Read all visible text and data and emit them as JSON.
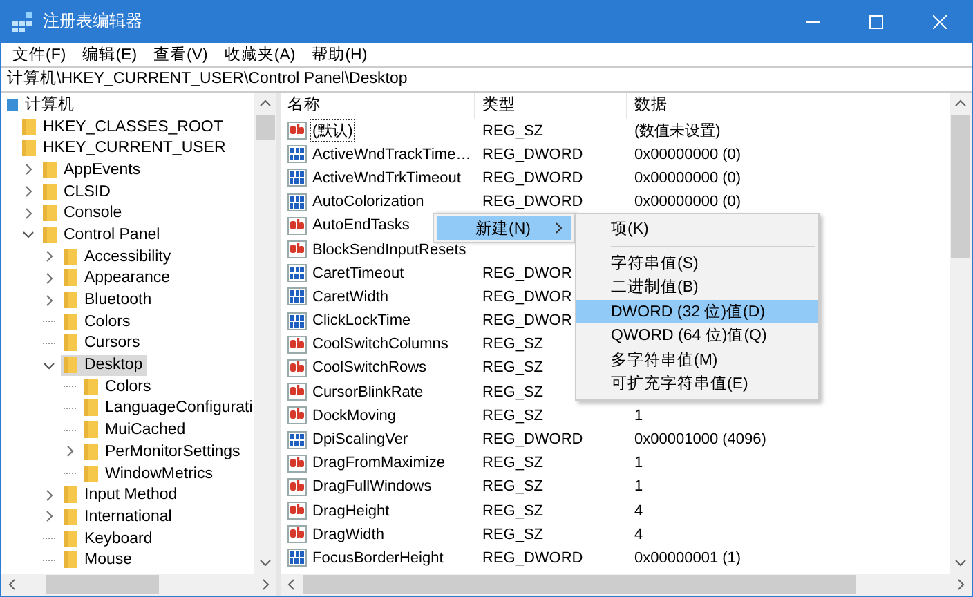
{
  "window": {
    "title": "注册表编辑器"
  },
  "menu": [
    "文件(F)",
    "编辑(E)",
    "查看(V)",
    "收藏夹(A)",
    "帮助(H)"
  ],
  "address": "计算机\\HKEY_CURRENT_USER\\Control Panel\\Desktop",
  "tree": {
    "items": [
      {
        "label": "计算机",
        "kind": "computer",
        "selected": false,
        "children": [
          {
            "label": "HKEY_CLASSES_ROOT",
            "kind": "folder",
            "selected": false
          },
          {
            "label": "HKEY_CURRENT_USER",
            "kind": "folder",
            "selected": false,
            "children": [
              {
                "label": "AppEvents",
                "kind": "folder",
                "expanded": false,
                "selected": false
              },
              {
                "label": "CLSID",
                "kind": "folder",
                "expanded": false,
                "selected": false
              },
              {
                "label": "Console",
                "kind": "folder",
                "expanded": false,
                "selected": false
              },
              {
                "label": "Control Panel",
                "kind": "folder",
                "expanded": true,
                "selected": false,
                "children": [
                  {
                    "label": "Accessibility",
                    "kind": "folder",
                    "expanded": false,
                    "selected": false
                  },
                  {
                    "label": "Appearance",
                    "kind": "folder",
                    "expanded": false,
                    "selected": false
                  },
                  {
                    "label": "Bluetooth",
                    "kind": "folder",
                    "expanded": false,
                    "selected": false
                  },
                  {
                    "label": "Colors",
                    "kind": "folder",
                    "selected": false
                  },
                  {
                    "label": "Cursors",
                    "kind": "folder",
                    "selected": false
                  },
                  {
                    "label": "Desktop",
                    "kind": "folder",
                    "expanded": true,
                    "selected": true,
                    "children": [
                      {
                        "label": "Colors",
                        "kind": "folder",
                        "selected": false
                      },
                      {
                        "label": "LanguageConfigurati",
                        "kind": "folder",
                        "selected": false
                      },
                      {
                        "label": "MuiCached",
                        "kind": "folder",
                        "selected": false
                      },
                      {
                        "label": "PerMonitorSettings",
                        "kind": "folder",
                        "expanded": false,
                        "selected": false
                      },
                      {
                        "label": "WindowMetrics",
                        "kind": "folder",
                        "selected": false
                      }
                    ]
                  },
                  {
                    "label": "Input Method",
                    "kind": "folder",
                    "expanded": false,
                    "selected": false
                  },
                  {
                    "label": "International",
                    "kind": "folder",
                    "expanded": false,
                    "selected": false
                  },
                  {
                    "label": "Keyboard",
                    "kind": "folder",
                    "selected": false
                  },
                  {
                    "label": "Mouse",
                    "kind": "folder",
                    "selected": false
                  }
                ]
              }
            ]
          }
        ]
      }
    ]
  },
  "table": {
    "columns": [
      "名称",
      "类型",
      "数据"
    ],
    "rows": [
      {
        "name": "(默认)",
        "kind": "string",
        "focused": true,
        "type": "REG_SZ",
        "data": "(数值未设置)"
      },
      {
        "name": "ActiveWndTrackTime…",
        "kind": "binary",
        "focused": false,
        "type": "REG_DWORD",
        "data": "0x00000000 (0)"
      },
      {
        "name": "ActiveWndTrkTimeout",
        "kind": "binary",
        "focused": false,
        "type": "REG_DWORD",
        "data": "0x00000000 (0)"
      },
      {
        "name": "AutoColorization",
        "kind": "binary",
        "focused": false,
        "type": "REG_DWORD",
        "data": "0x00000000 (0)"
      },
      {
        "name": "AutoEndTasks",
        "kind": "string",
        "focused": false
      },
      {
        "name": "BlockSendInputResets",
        "kind": "string",
        "focused": false
      },
      {
        "name": "CaretTimeout",
        "kind": "binary",
        "focused": false,
        "type": "REG_DWOR"
      },
      {
        "name": "CaretWidth",
        "kind": "binary",
        "focused": false,
        "type": "REG_DWOR"
      },
      {
        "name": "ClickLockTime",
        "kind": "binary",
        "focused": false,
        "type": "REG_DWOR"
      },
      {
        "name": "CoolSwitchColumns",
        "kind": "string",
        "focused": false,
        "type": "REG_SZ"
      },
      {
        "name": "CoolSwitchRows",
        "kind": "string",
        "focused": false,
        "type": "REG_SZ"
      },
      {
        "name": "CursorBlinkRate",
        "kind": "string",
        "focused": false,
        "type": "REG_SZ"
      },
      {
        "name": "DockMoving",
        "kind": "string",
        "focused": false,
        "type": "REG_SZ",
        "data": "1"
      },
      {
        "name": "DpiScalingVer",
        "kind": "binary",
        "focused": false,
        "type": "REG_DWORD",
        "data": "0x00001000 (4096)"
      },
      {
        "name": "DragFromMaximize",
        "kind": "string",
        "focused": false,
        "type": "REG_SZ",
        "data": "1"
      },
      {
        "name": "DragFullWindows",
        "kind": "string",
        "focused": false,
        "type": "REG_SZ",
        "data": "1"
      },
      {
        "name": "DragHeight",
        "kind": "string",
        "focused": false,
        "type": "REG_SZ",
        "data": "4"
      },
      {
        "name": "DragWidth",
        "kind": "string",
        "focused": false,
        "type": "REG_SZ",
        "data": "4"
      },
      {
        "name": "FocusBorderHeight",
        "kind": "binary",
        "focused": false,
        "type": "REG_DWORD",
        "data": "0x00000001 (1)"
      }
    ]
  },
  "context_menu": {
    "items": [
      {
        "label": "新建(N)",
        "selected": true,
        "submenu": true
      }
    ]
  },
  "submenu": {
    "items": [
      {
        "kind": "item",
        "label": "项(K)",
        "selected": false
      },
      {
        "kind": "separator"
      },
      {
        "kind": "item",
        "label": "字符串值(S)",
        "selected": false
      },
      {
        "kind": "item",
        "label": "二进制值(B)",
        "selected": false
      },
      {
        "kind": "item",
        "label": "DWORD (32 位)值(D)",
        "selected": true
      },
      {
        "kind": "item",
        "label": "QWORD (64 位)值(Q)",
        "selected": false
      },
      {
        "kind": "item",
        "label": "多字符串值(M)",
        "selected": false
      },
      {
        "kind": "item",
        "label": "可扩充字符串值(E)",
        "selected": false
      }
    ]
  }
}
